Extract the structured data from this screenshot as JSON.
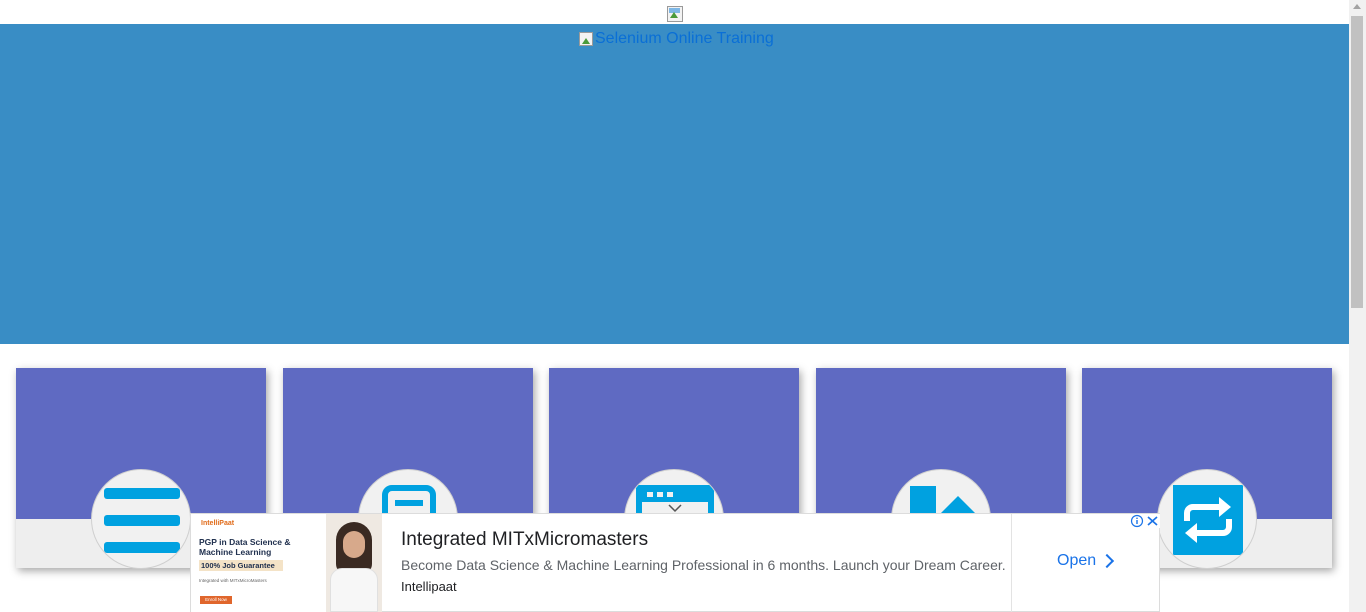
{
  "header": {
    "top_image_alt": "",
    "banner_alt": "Selenium Online Training"
  },
  "colors": {
    "hero": "#398dc5",
    "card_band": "#5f6ac2",
    "icon_blue": "#00a1e0"
  },
  "cards": [
    {
      "icon": "menu-icon"
    },
    {
      "icon": "document-icon"
    },
    {
      "icon": "browser-window-icon"
    },
    {
      "icon": "kotlin-logo-icon"
    },
    {
      "icon": "repeat-icon"
    }
  ],
  "ad": {
    "image": {
      "brand": "IntelliPaat",
      "headline": "PGP in Data Science & Machine Learning",
      "badge": "100% Job Guarantee",
      "note": "Integrated with MITxMicroMasters",
      "cta": "Enroll Now"
    },
    "title": "Integrated MITxMicromasters",
    "description": "Become Data Science & Machine Learning Professional in 6 months. Launch your Dream Career.",
    "advertiser": "Intellipaat",
    "open_label": "Open"
  }
}
